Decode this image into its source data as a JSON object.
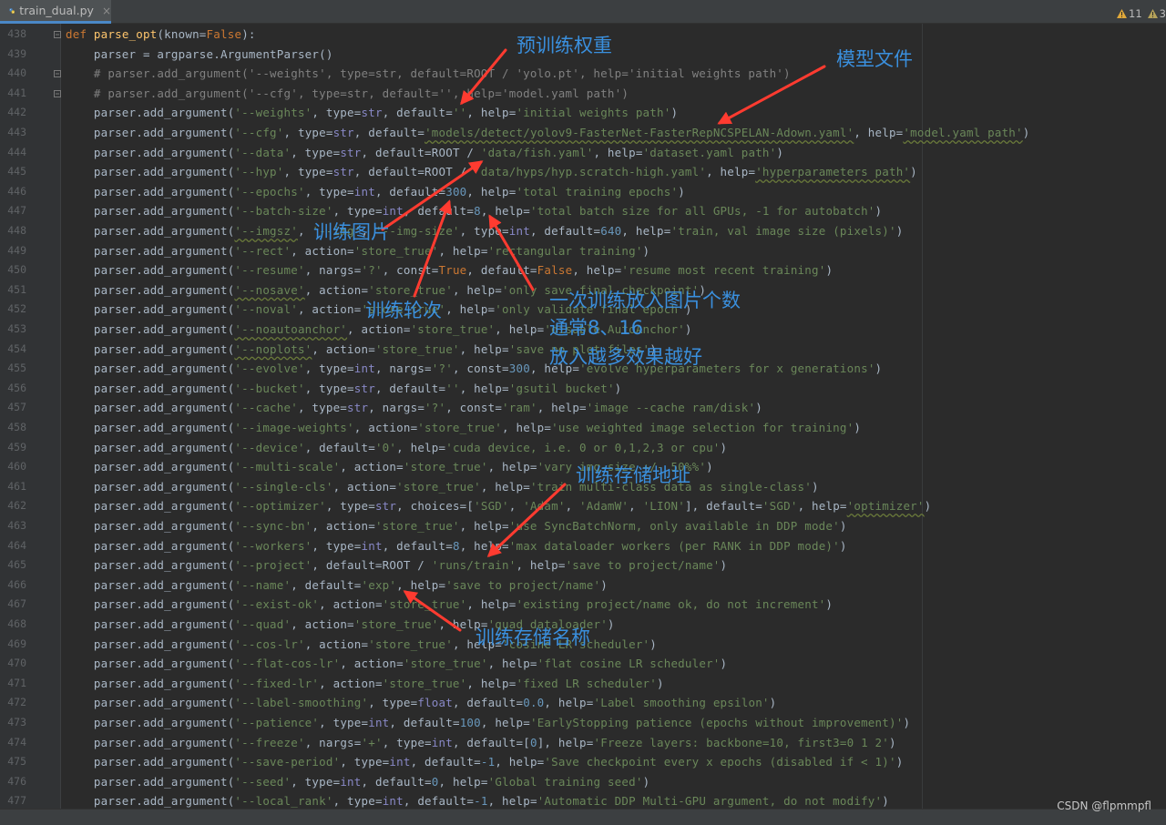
{
  "tab": {
    "filename": "train_dual.py",
    "close": "×",
    "icon": "python-file-icon"
  },
  "inspections": {
    "warnings": "11",
    "weak_warnings": "3"
  },
  "watermark": "CSDN @flpmmpfl",
  "colors": {
    "background": "#2b2b2b",
    "keyword": "#cc7832",
    "string": "#6a8759",
    "number": "#6897bb",
    "comment": "#808080",
    "function": "#ffc66d",
    "annotation": "#3a8fdd",
    "arrow": "#ff3b30"
  },
  "code": {
    "lines": [
      {
        "n": "438",
        "t": "def parse_opt(known=False):"
      },
      {
        "n": "439",
        "t": "    parser = argparse.ArgumentParser()"
      },
      {
        "n": "440",
        "t": "    # parser.add_argument('--weights', type=str, default=ROOT / 'yolo.pt', help='initial weights path')"
      },
      {
        "n": "441",
        "t": "    # parser.add_argument('--cfg', type=str, default='', help='model.yaml path')"
      },
      {
        "n": "442",
        "t": "    parser.add_argument('--weights', type=str, default='', help='initial weights path')"
      },
      {
        "n": "443",
        "t": "    parser.add_argument('--cfg', type=str, default='models/detect/yolov9-FasterNet-FasterRepNCSPELAN-Adown.yaml', help='model.yaml path')"
      },
      {
        "n": "444",
        "t": "    parser.add_argument('--data', type=str, default=ROOT / 'data/fish.yaml', help='dataset.yaml path')"
      },
      {
        "n": "445",
        "t": "    parser.add_argument('--hyp', type=str, default=ROOT / 'data/hyps/hyp.scratch-high.yaml', help='hyperparameters path')"
      },
      {
        "n": "446",
        "t": "    parser.add_argument('--epochs', type=int, default=300, help='total training epochs')"
      },
      {
        "n": "447",
        "t": "    parser.add_argument('--batch-size', type=int, default=8, help='total batch size for all GPUs, -1 for autobatch')"
      },
      {
        "n": "448",
        "t": "    parser.add_argument('--imgsz', '--img', '--img-size', type=int, default=640, help='train, val image size (pixels)')"
      },
      {
        "n": "449",
        "t": "    parser.add_argument('--rect', action='store_true', help='rectangular training')"
      },
      {
        "n": "450",
        "t": "    parser.add_argument('--resume', nargs='?', const=True, default=False, help='resume most recent training')"
      },
      {
        "n": "451",
        "t": "    parser.add_argument('--nosave', action='store_true', help='only save final checkpoint')"
      },
      {
        "n": "452",
        "t": "    parser.add_argument('--noval', action='store_true', help='only validate final epoch')"
      },
      {
        "n": "453",
        "t": "    parser.add_argument('--noautoanchor', action='store_true', help='disable AutoAnchor')"
      },
      {
        "n": "454",
        "t": "    parser.add_argument('--noplots', action='store_true', help='save no plot files')"
      },
      {
        "n": "455",
        "t": "    parser.add_argument('--evolve', type=int, nargs='?', const=300, help='evolve hyperparameters for x generations')"
      },
      {
        "n": "456",
        "t": "    parser.add_argument('--bucket', type=str, default='', help='gsutil bucket')"
      },
      {
        "n": "457",
        "t": "    parser.add_argument('--cache', type=str, nargs='?', const='ram', help='image --cache ram/disk')"
      },
      {
        "n": "458",
        "t": "    parser.add_argument('--image-weights', action='store_true', help='use weighted image selection for training')"
      },
      {
        "n": "459",
        "t": "    parser.add_argument('--device', default='0', help='cuda device, i.e. 0 or 0,1,2,3 or cpu')"
      },
      {
        "n": "460",
        "t": "    parser.add_argument('--multi-scale', action='store_true', help='vary img-size +/- 50%%')"
      },
      {
        "n": "461",
        "t": "    parser.add_argument('--single-cls', action='store_true', help='train multi-class data as single-class')"
      },
      {
        "n": "462",
        "t": "    parser.add_argument('--optimizer', type=str, choices=['SGD', 'Adam', 'AdamW', 'LION'], default='SGD', help='optimizer')"
      },
      {
        "n": "463",
        "t": "    parser.add_argument('--sync-bn', action='store_true', help='use SyncBatchNorm, only available in DDP mode')"
      },
      {
        "n": "464",
        "t": "    parser.add_argument('--workers', type=int, default=8, help='max dataloader workers (per RANK in DDP mode)')"
      },
      {
        "n": "465",
        "t": "    parser.add_argument('--project', default=ROOT / 'runs/train', help='save to project/name')"
      },
      {
        "n": "466",
        "t": "    parser.add_argument('--name', default='exp', help='save to project/name')"
      },
      {
        "n": "467",
        "t": "    parser.add_argument('--exist-ok', action='store_true', help='existing project/name ok, do not increment')"
      },
      {
        "n": "468",
        "t": "    parser.add_argument('--quad', action='store_true', help='quad dataloader')"
      },
      {
        "n": "469",
        "t": "    parser.add_argument('--cos-lr', action='store_true', help='cosine LR scheduler')"
      },
      {
        "n": "470",
        "t": "    parser.add_argument('--flat-cos-lr', action='store_true', help='flat cosine LR scheduler')"
      },
      {
        "n": "471",
        "t": "    parser.add_argument('--fixed-lr', action='store_true', help='fixed LR scheduler')"
      },
      {
        "n": "472",
        "t": "    parser.add_argument('--label-smoothing', type=float, default=0.0, help='Label smoothing epsilon')"
      },
      {
        "n": "473",
        "t": "    parser.add_argument('--patience', type=int, default=100, help='EarlyStopping patience (epochs without improvement)')"
      },
      {
        "n": "474",
        "t": "    parser.add_argument('--freeze', nargs='+', type=int, default=[0], help='Freeze layers: backbone=10, first3=0 1 2')"
      },
      {
        "n": "475",
        "t": "    parser.add_argument('--save-period', type=int, default=-1, help='Save checkpoint every x epochs (disabled if < 1)')"
      },
      {
        "n": "476",
        "t": "    parser.add_argument('--seed', type=int, default=0, help='Global training seed')"
      },
      {
        "n": "477",
        "t": "    parser.add_argument('--local_rank', type=int, default=-1, help='Automatic DDP Multi-GPU argument, do not modify')"
      }
    ]
  },
  "annotations": {
    "weights": "预训练权重",
    "model_file": "模型文件",
    "train_images": "训练图片",
    "epochs": "训练轮次",
    "batch_line1": "一次训练放入图片个数",
    "batch_line2": "通常8、16",
    "batch_line3": "放入越多效果越好",
    "save_dir": "训练存储地址",
    "save_name": "训练存储名称"
  }
}
